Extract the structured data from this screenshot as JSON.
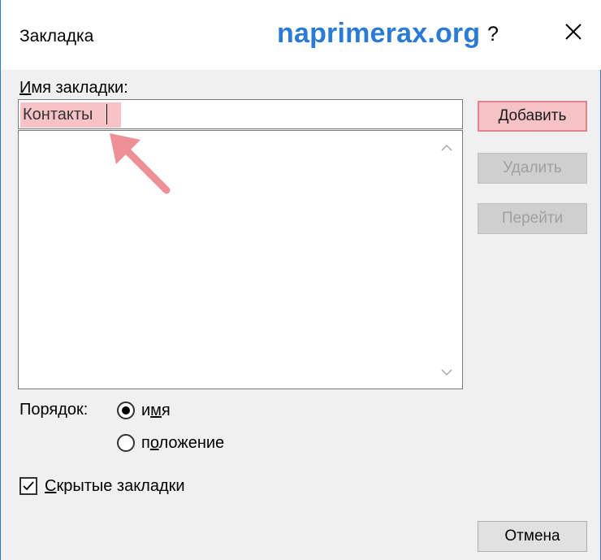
{
  "window": {
    "title": "Закладка",
    "watermark": "naprimerax.org",
    "help": "?"
  },
  "bookmark_name": {
    "label": "Имя закладки:",
    "label_underline_char": "И",
    "label_rest": "мя закладки:",
    "value": "Контакты"
  },
  "bookmark_list": {
    "items": []
  },
  "buttons": {
    "add": {
      "u": "Д",
      "rest": "обавить",
      "enabled": true
    },
    "delete": {
      "label": "Удалить",
      "enabled": false
    },
    "goto": {
      "label": "Перейти",
      "enabled": false
    },
    "cancel": {
      "label": "Отмена",
      "enabled": true
    }
  },
  "order": {
    "label": "Порядок:",
    "options": [
      {
        "pre": "и",
        "u": "м",
        "post": "я",
        "selected": true
      },
      {
        "pre": "п",
        "u": "о",
        "post": "ложение",
        "selected": false
      }
    ]
  },
  "hidden_bookmarks": {
    "u": "С",
    "rest": "крытые закладки",
    "checked": true
  },
  "colors": {
    "accent": "#2a7bd5",
    "highlight": "#f7c3c7",
    "annotation_arrow": "#ef8f96"
  }
}
